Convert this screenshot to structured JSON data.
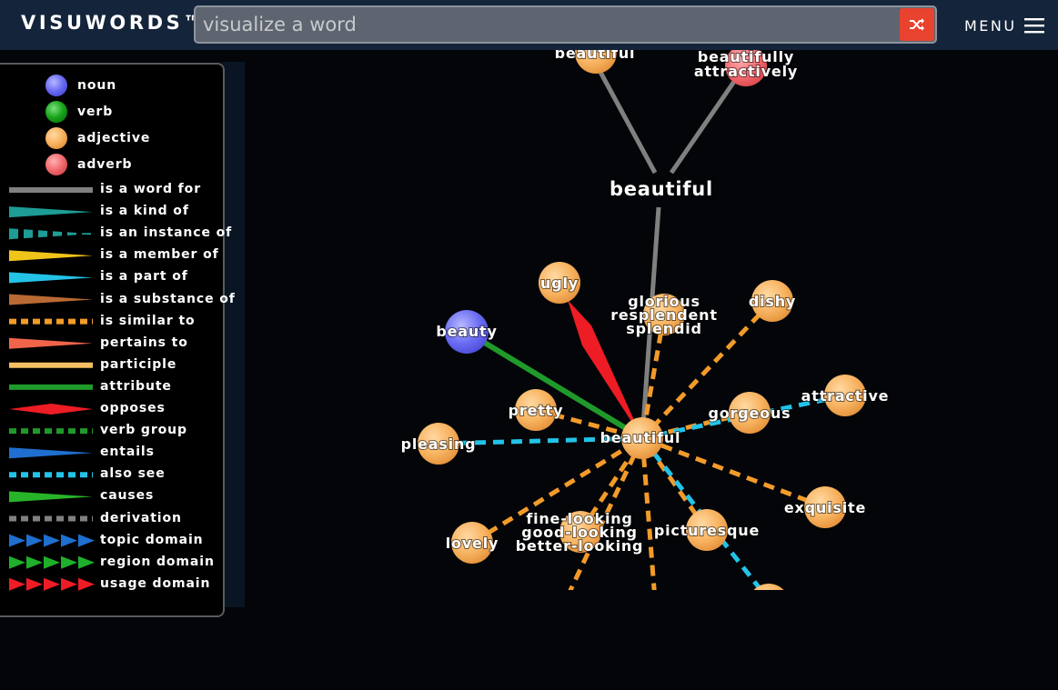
{
  "app": {
    "logo": "VISUWORDS™",
    "search_placeholder": "visualize a word",
    "menu_label": "MENU"
  },
  "legend": {
    "node_types": [
      {
        "label": "noun",
        "color": "#6a6cf2"
      },
      {
        "label": "verb",
        "color": "#18a51a"
      },
      {
        "label": "adjective",
        "color": "#f7b25f"
      },
      {
        "label": "adverb",
        "color": "#f26a6e"
      }
    ],
    "relations": [
      {
        "label": "is a word for",
        "style": "solid",
        "color": "#808080"
      },
      {
        "label": "is a kind of",
        "style": "taper",
        "color": "#1e9c96"
      },
      {
        "label": "is an instance of",
        "style": "dashtaper",
        "color": "#1e9c96"
      },
      {
        "label": "is a member of",
        "style": "taper",
        "color": "#f0c419"
      },
      {
        "label": "is a part of",
        "style": "taper",
        "color": "#23c3e8"
      },
      {
        "label": "is a substance of",
        "style": "taper",
        "color": "#b96a32"
      },
      {
        "label": "is similar to",
        "style": "dashed",
        "color": "#f39b2a"
      },
      {
        "label": "pertains to",
        "style": "taper",
        "color": "#f0654a"
      },
      {
        "label": "participle",
        "style": "solid",
        "color": "#f5c064"
      },
      {
        "label": "attribute",
        "style": "solid",
        "color": "#1f9a2a"
      },
      {
        "label": "opposes",
        "style": "diamond",
        "color": "#ee1c24"
      },
      {
        "label": "verb group",
        "style": "dashed",
        "color": "#1f9a2a"
      },
      {
        "label": "entails",
        "style": "taper",
        "color": "#1e6fd0"
      },
      {
        "label": "also see",
        "style": "dashed",
        "color": "#23c3e8"
      },
      {
        "label": "causes",
        "style": "taper",
        "color": "#28b428"
      },
      {
        "label": "derivation",
        "style": "dashed",
        "color": "#808080"
      },
      {
        "label": "topic domain",
        "style": "arrows",
        "color": "#1e6fd0"
      },
      {
        "label": "region domain",
        "style": "arrows",
        "color": "#1fb02b"
      },
      {
        "label": "usage domain",
        "style": "arrows",
        "color": "#ee1c24"
      }
    ]
  },
  "graph": {
    "center_node": "beautiful",
    "top_word": "beautiful",
    "nodes": [
      {
        "id": "n-beautiful-top",
        "label": "beautiful",
        "type": "adjective"
      },
      {
        "id": "n-beautifully",
        "label": "beautifully attractively",
        "type": "adverb"
      },
      {
        "id": "n-ugly",
        "label": "ugly",
        "type": "adjective"
      },
      {
        "id": "n-glorious",
        "label": "glorious resplendent splendid",
        "type": "adjective"
      },
      {
        "id": "n-dishy",
        "label": "dishy",
        "type": "adjective"
      },
      {
        "id": "n-beauty",
        "label": "beauty",
        "type": "noun"
      },
      {
        "id": "n-attractive",
        "label": "attractive",
        "type": "adjective"
      },
      {
        "id": "n-gorgeous",
        "label": "gorgeous",
        "type": "adjective"
      },
      {
        "id": "n-pretty",
        "label": "pretty",
        "type": "adjective"
      },
      {
        "id": "n-pleasing",
        "label": "pleasing",
        "type": "adjective"
      },
      {
        "id": "n-exquisite",
        "label": "exquisite",
        "type": "adjective"
      },
      {
        "id": "n-lovely",
        "label": "lovely",
        "type": "adjective"
      },
      {
        "id": "n-fine-looking",
        "label": "fine-looking good-looking better-looking",
        "type": "adjective"
      },
      {
        "id": "n-picturesque",
        "label": "picturesque",
        "type": "adjective"
      },
      {
        "id": "n-offscreen-1",
        "label": "",
        "type": "adjective"
      }
    ],
    "labels": {
      "beautiful_top": "beautiful",
      "beautifully_1": "beautifully",
      "beautifully_2": "attractively",
      "ugly": "ugly",
      "glorious_1": "glorious",
      "glorious_2": "resplendent",
      "glorious_3": "splendid",
      "dishy": "dishy",
      "beauty": "beauty",
      "attractive": "attractive",
      "gorgeous": "gorgeous",
      "pretty": "pretty",
      "pleasing": "pleasing",
      "center": "beautiful",
      "exquisite": "exquisite",
      "lovely": "lovely",
      "fine_1": "fine-looking",
      "fine_2": "good-looking",
      "fine_3": "better-looking",
      "picturesque": "picturesque"
    }
  }
}
